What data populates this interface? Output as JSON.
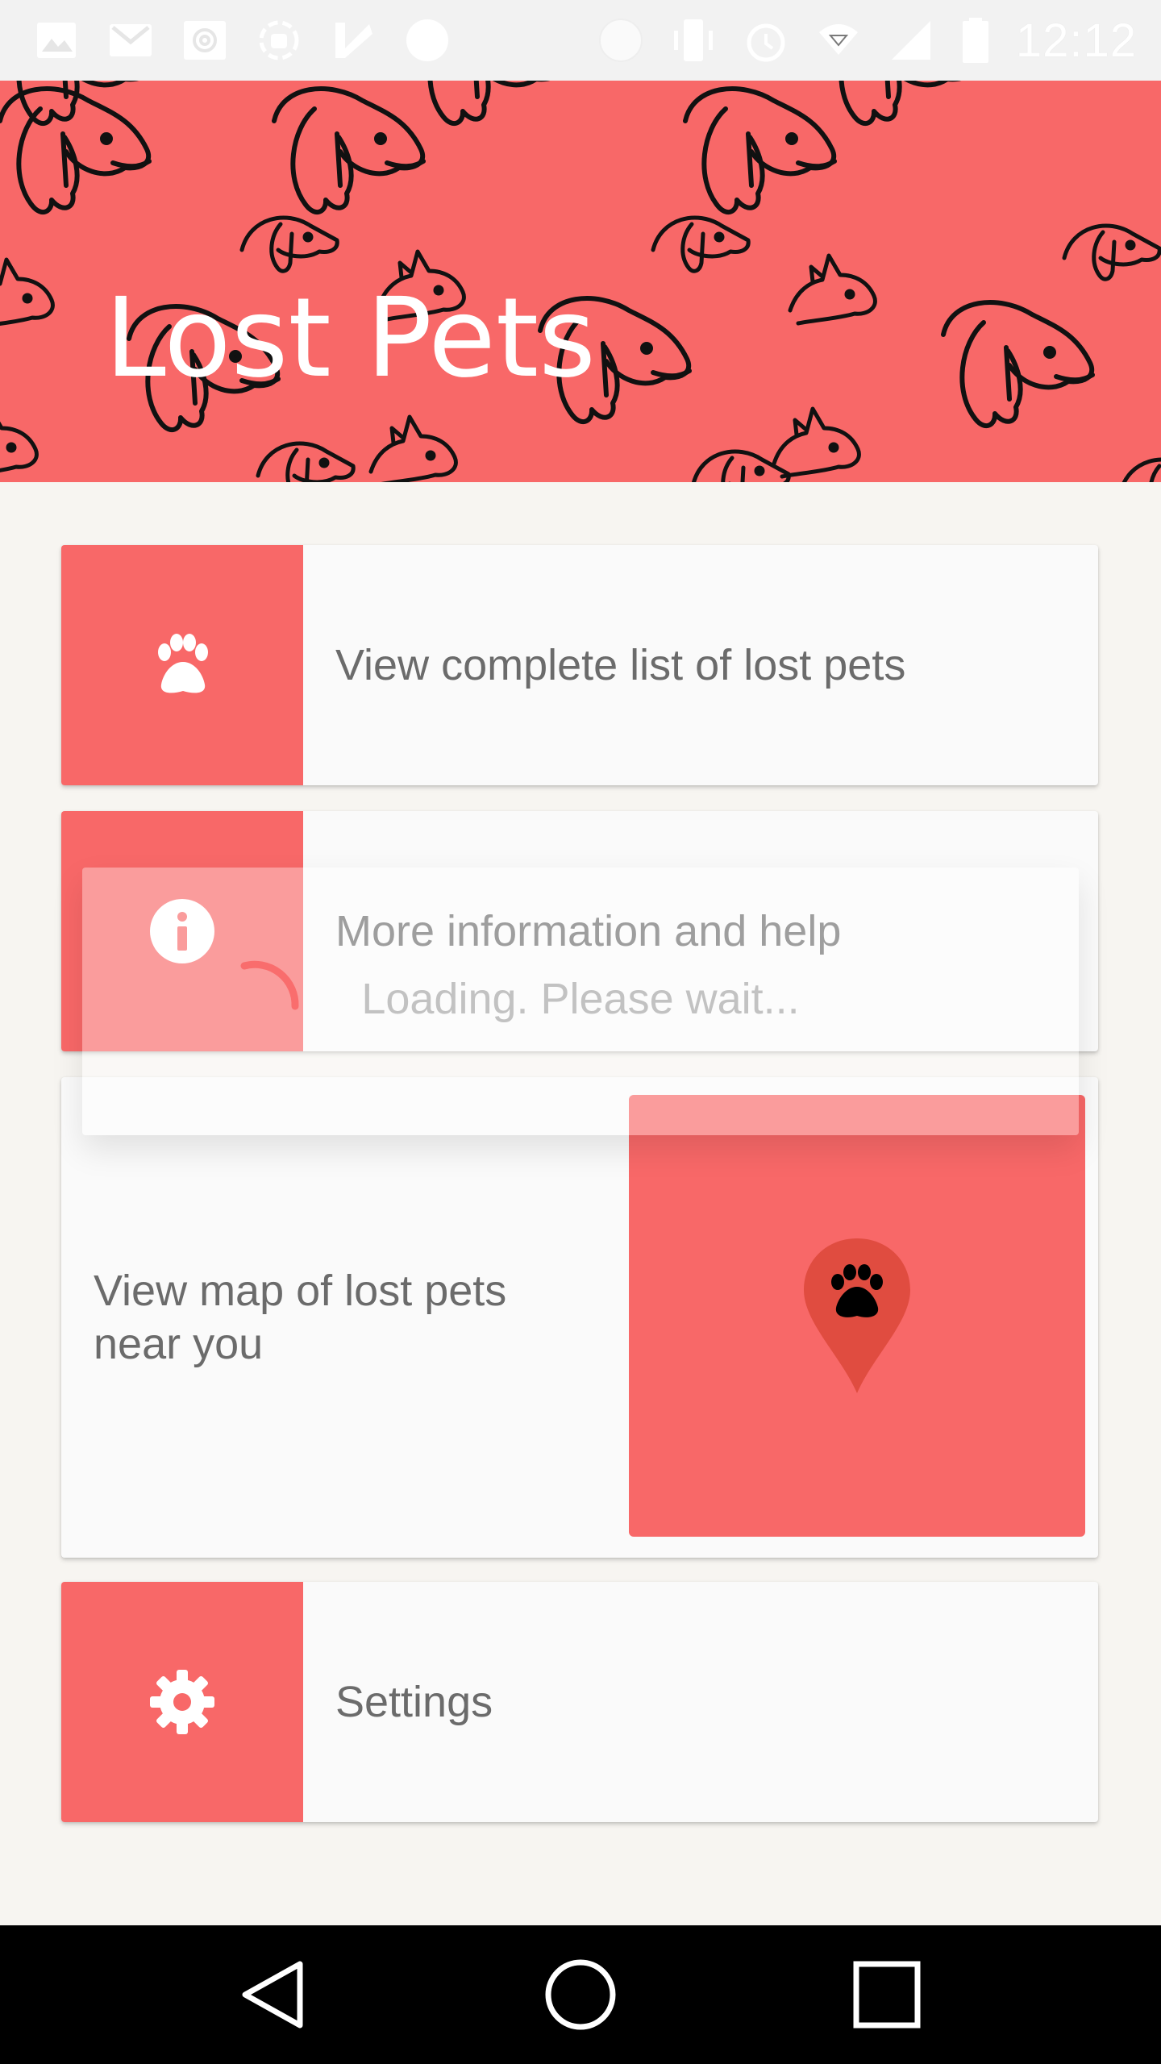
{
  "status_bar": {
    "time": "12:12",
    "left_icons": [
      "gallery-icon",
      "gmail-icon",
      "email-at-icon",
      "android-debug-icon",
      "checkmark-icon",
      "circle-notification-icon"
    ],
    "right_icons": [
      "do-not-disturb-icon",
      "vibrate-icon",
      "alarm-icon",
      "wifi-icon",
      "signal-icon",
      "battery-icon"
    ]
  },
  "header": {
    "title": "Lost Pets",
    "background_color": "#f86868"
  },
  "menu": {
    "list_label": "View complete list of lost pets",
    "info_label": "More information and help",
    "map_label": "View map of lost pets near you",
    "settings_label": "Settings"
  },
  "loading": {
    "text": "Loading. Please wait..."
  },
  "colors": {
    "accent": "#f86868",
    "pin": "#e04c40",
    "card": "#fafafa",
    "page": "#f7f5f1",
    "text": "#6b6b6b"
  }
}
